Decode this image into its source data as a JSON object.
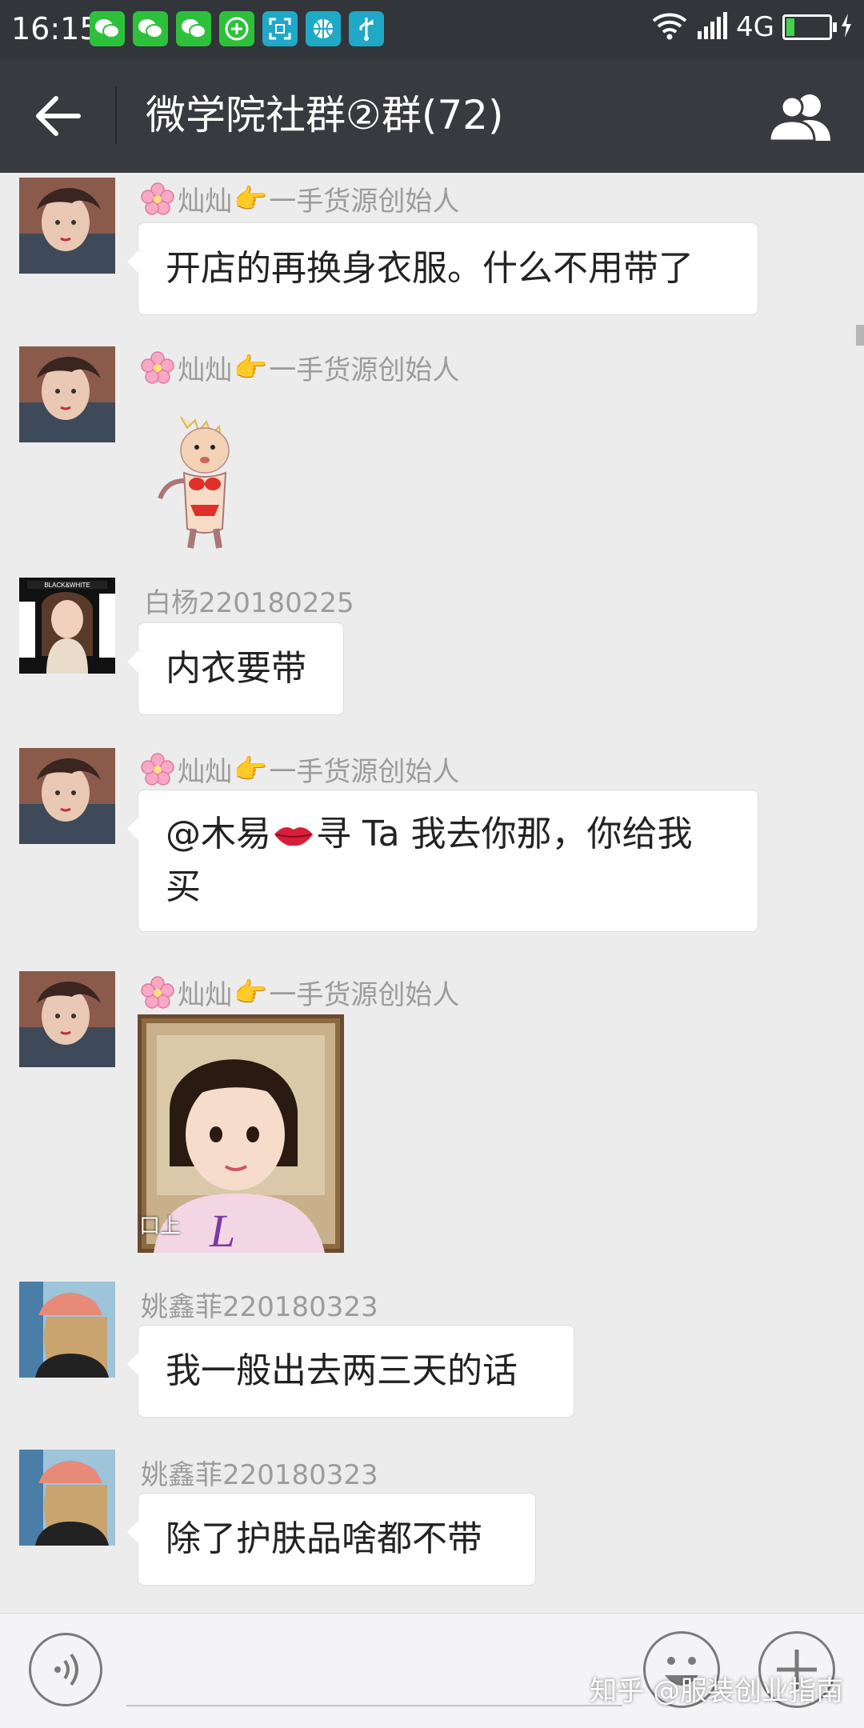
{
  "status_bar": {
    "time": "16:15",
    "network": "4G",
    "battery_level": 0.2,
    "app_icons": [
      "wechat-icon",
      "wechat-icon",
      "wechat-icon",
      "plus-app-icon",
      "scan-app-icon",
      "basketball-app-icon",
      "usb-icon"
    ]
  },
  "header": {
    "title": "微学院社群②群(72)"
  },
  "messages": [
    {
      "sender": "灿灿",
      "sender_suffix": "一手货源创始人",
      "text": "开店的再换身衣服。什么不用带了"
    },
    {
      "sender": "灿灿",
      "sender_suffix": "一手货源创始人",
      "sticker": "baby-dancing-sticker"
    },
    {
      "sender": "白杨220180225",
      "text": "内衣要带"
    },
    {
      "sender": "灿灿",
      "sender_suffix": "一手货源创始人",
      "text_line1": "@木易",
      "text_line1b": "寻 Ta  我去你那，你给我",
      "text_line2": "买"
    },
    {
      "sender": "灿灿",
      "sender_suffix": "一手货源创始人",
      "image": "little-girl-photo",
      "image_caption": "口上"
    },
    {
      "sender": "姚鑫菲220180323",
      "text": "我一般出去两三天的话"
    },
    {
      "sender": "姚鑫菲220180323",
      "text": "除了护肤品啥都不带"
    }
  ],
  "watermark": "知乎 @服装创业指南",
  "colors": {
    "header_bg": "#393a3f",
    "status_bg": "#323539",
    "chat_bg": "#ececec",
    "bubble_bg": "#ffffff"
  }
}
